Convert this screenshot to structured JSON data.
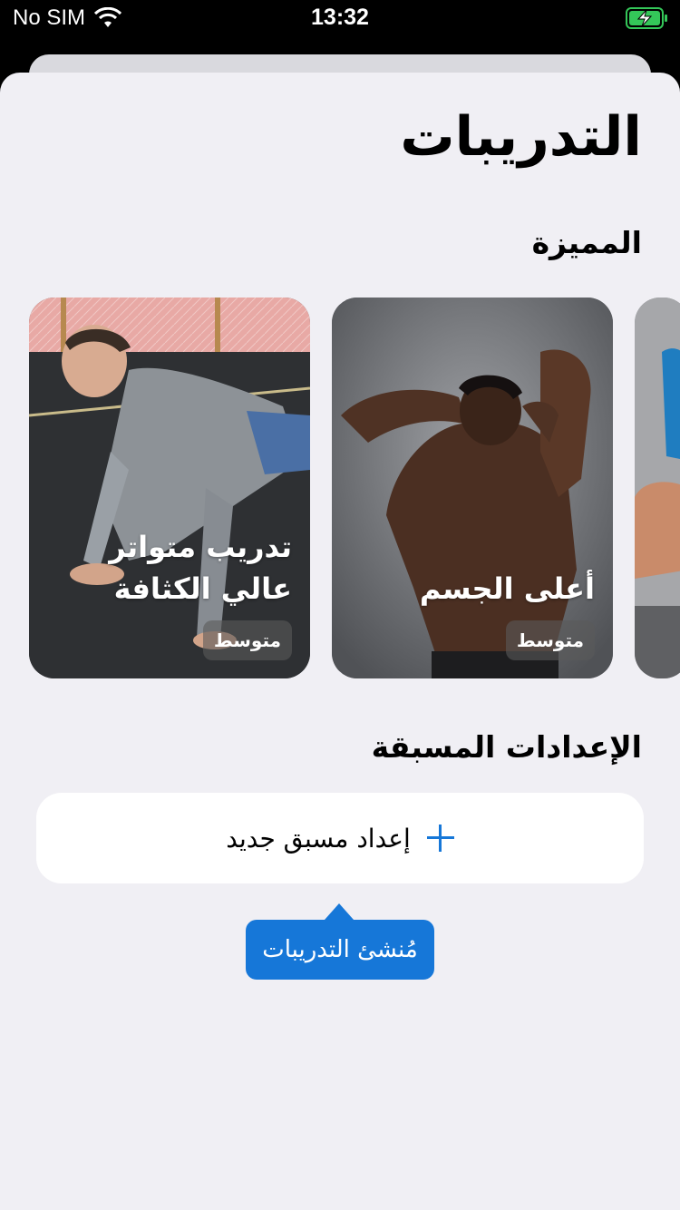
{
  "status": {
    "carrier": "No SIM",
    "time": "13:32",
    "battery_color": "#34c759"
  },
  "page": {
    "title": "التدريبات"
  },
  "featured": {
    "title": "المميزة",
    "cards": [
      {
        "title_line1": "تدريب متواتر",
        "title_line2": "عالي الكثافة",
        "badge": "متوسط"
      },
      {
        "title_line1": "أعلى الجسم",
        "badge": "متوسط"
      }
    ]
  },
  "presets": {
    "title": "الإعدادات المسبقة",
    "new_label": "إعداد مسبق جديد"
  },
  "tooltip": {
    "text": "مُنشئ التدريبات"
  },
  "colors": {
    "accent": "#1677d8",
    "background": "#f0eff4"
  }
}
